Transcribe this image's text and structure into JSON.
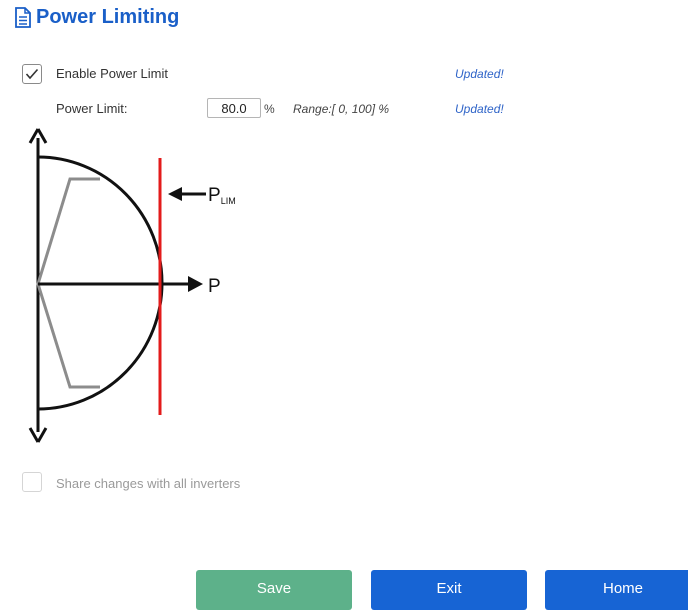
{
  "header": {
    "title": "Power Limiting",
    "icon": "document-icon"
  },
  "enable_power_limit": {
    "label": "Enable Power Limit",
    "checked": true,
    "status": "Updated!"
  },
  "power_limit": {
    "label": "Power Limit:",
    "value": "80.0",
    "unit": "%",
    "range": "Range:[ 0, 100] %",
    "status": "Updated!"
  },
  "diagram": {
    "p_label": "P",
    "p_lim_main": "P",
    "p_lim_sub": "LIM"
  },
  "share": {
    "label": "Share changes with all inverters",
    "checked": false
  },
  "buttons": {
    "save": "Save",
    "exit": "Exit",
    "home": "Home"
  },
  "colors": {
    "accent": "#1a5fc8",
    "save": "#5db18a",
    "primary": "#1764d4",
    "limit_line": "#e31b1b"
  }
}
